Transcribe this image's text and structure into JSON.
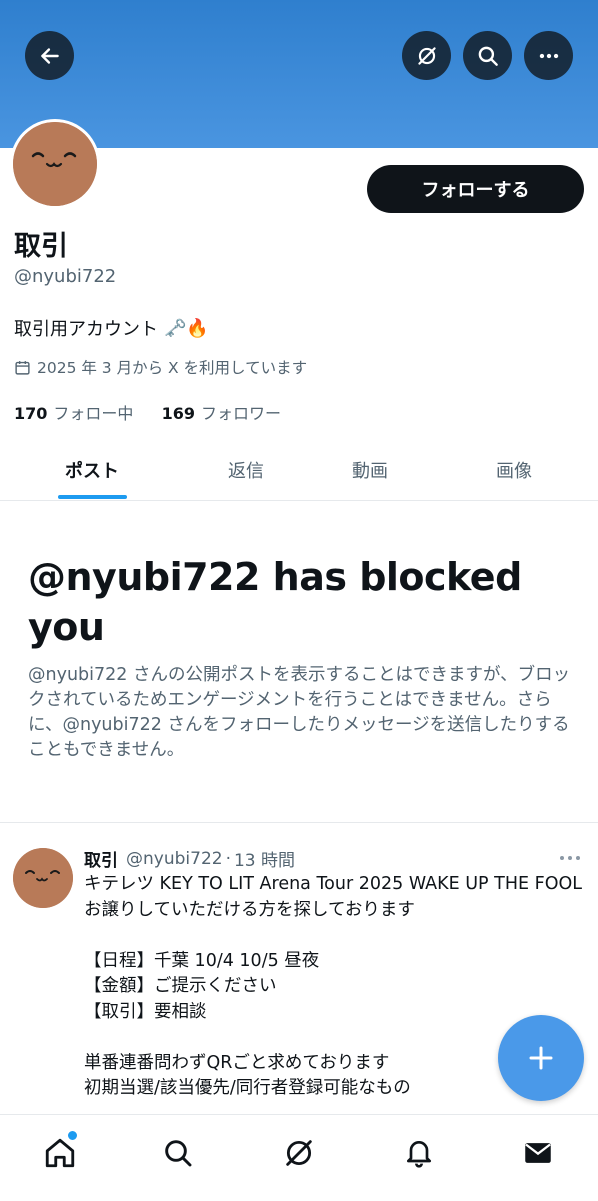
{
  "header": {
    "back_icon": "arrow-left-icon",
    "grok_icon": "grok-icon",
    "search_icon": "search-icon",
    "more_icon": "more-icon",
    "banner_color": "#3a8ad8"
  },
  "profile": {
    "follow_label": "フォローする",
    "name": "取引",
    "handle": "@nyubi722",
    "bio": "取引用アカウント",
    "bio_emojis": "🗝️🔥",
    "joined": "2025 年 3 月から X を利用しています",
    "following_count": "170",
    "following_label": "フォロー中",
    "followers_count": "169",
    "followers_label": "フォロワー"
  },
  "tabs": [
    {
      "label": "ポスト",
      "active": true
    },
    {
      "label": "返信",
      "active": false
    },
    {
      "label": "動画",
      "active": false
    },
    {
      "label": "画像",
      "active": false
    }
  ],
  "blocked": {
    "title": "@nyubi722 has blocked you",
    "body": "@nyubi722 さんの公開ポストを表示することはできますが、ブロックされているためエンゲージメントを行うことはできません。さらに、@nyubi722 さんをフォローしたりメッセージを送信したりすることもできません。"
  },
  "post": {
    "name": "取引",
    "handle": "@nyubi722",
    "separator": "·",
    "time": "13 時間",
    "text": "キテレツ KEY TO LIT Arena Tour 2025 WAKE UP THE FOOL お譲りしていただける方を探しております\n\n【日程】千葉 10/4 10/5 昼夜\n【金額】ご提示ください\n【取引】要相談\n\n単番連番問わずQRごと求めております\n初期当選/該当優先/同行者登録可能なもの"
  },
  "fab": {
    "icon": "plus-icon",
    "color": "#4a99e9"
  },
  "bottom_nav": {
    "items": [
      "home-icon",
      "search-icon",
      "grok-icon",
      "bell-icon",
      "mail-icon"
    ],
    "accent": "#1d9bf0"
  }
}
